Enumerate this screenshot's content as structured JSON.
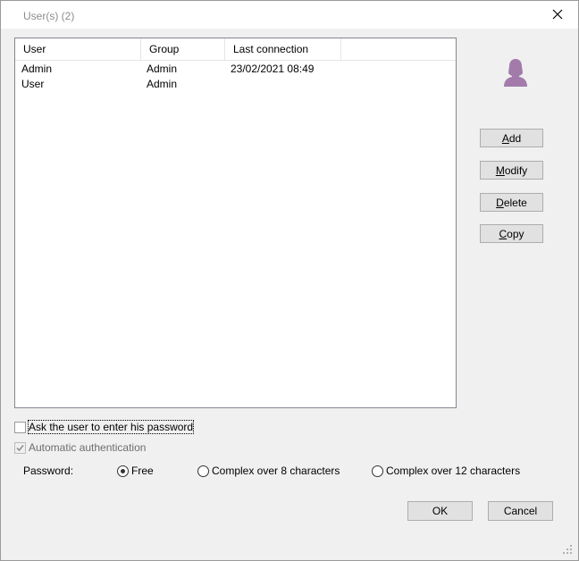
{
  "window": {
    "title": "User(s) (2)"
  },
  "list": {
    "columns": [
      "User",
      "Group",
      "Last connection"
    ],
    "rows": [
      [
        "Admin",
        "Admin",
        "23/02/2021 08:49"
      ],
      [
        "User",
        "Admin",
        ""
      ]
    ]
  },
  "buttons": {
    "add": {
      "mnemonic": "A",
      "rest": "dd"
    },
    "modify": {
      "mnemonic": "M",
      "rest": "odify"
    },
    "delete": {
      "mnemonic": "D",
      "rest": "elete"
    },
    "copy": {
      "mnemonic": "C",
      "rest": "opy"
    },
    "ok": "OK",
    "cancel": "Cancel"
  },
  "options": {
    "ask_password": {
      "label": "Ask the user to enter his password",
      "checked": false
    },
    "auto_auth": {
      "label": "Automatic authentication",
      "checked": true,
      "enabled": false
    }
  },
  "password": {
    "label": "Password:",
    "choices": [
      "Free",
      "Complex over 8 characters",
      "Complex over 12 characters"
    ],
    "selected": "Free"
  },
  "colors": {
    "avatar": "#a27bab",
    "accent": "#0078d7"
  },
  "icons": {
    "close": "close-icon",
    "avatar": "user-avatar-icon",
    "grip": "resize-grip-icon"
  }
}
